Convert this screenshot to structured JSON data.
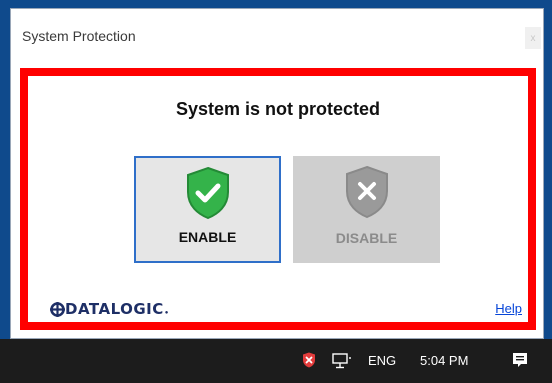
{
  "window": {
    "title": "System Protection",
    "close_label": "x"
  },
  "main": {
    "status_text": "System is not protected",
    "enable_label": "ENABLE",
    "disable_label": "DISABLE",
    "enable_icon": "shield-check-icon",
    "disable_icon": "shield-x-icon",
    "help_label": "Help"
  },
  "brand": {
    "logo_text": "DATALOGIC"
  },
  "taskbar": {
    "language": "ENG",
    "time": "5:04 PM"
  },
  "colors": {
    "frame_red": "#ff0000",
    "enable_green": "#34b34a",
    "disabled_gray": "#9a9a9a",
    "selected_border": "#2f6fc9",
    "desktop_blue": "#0f4a8c",
    "taskbar": "#1c1c1c",
    "link_blue": "#0645d8"
  }
}
